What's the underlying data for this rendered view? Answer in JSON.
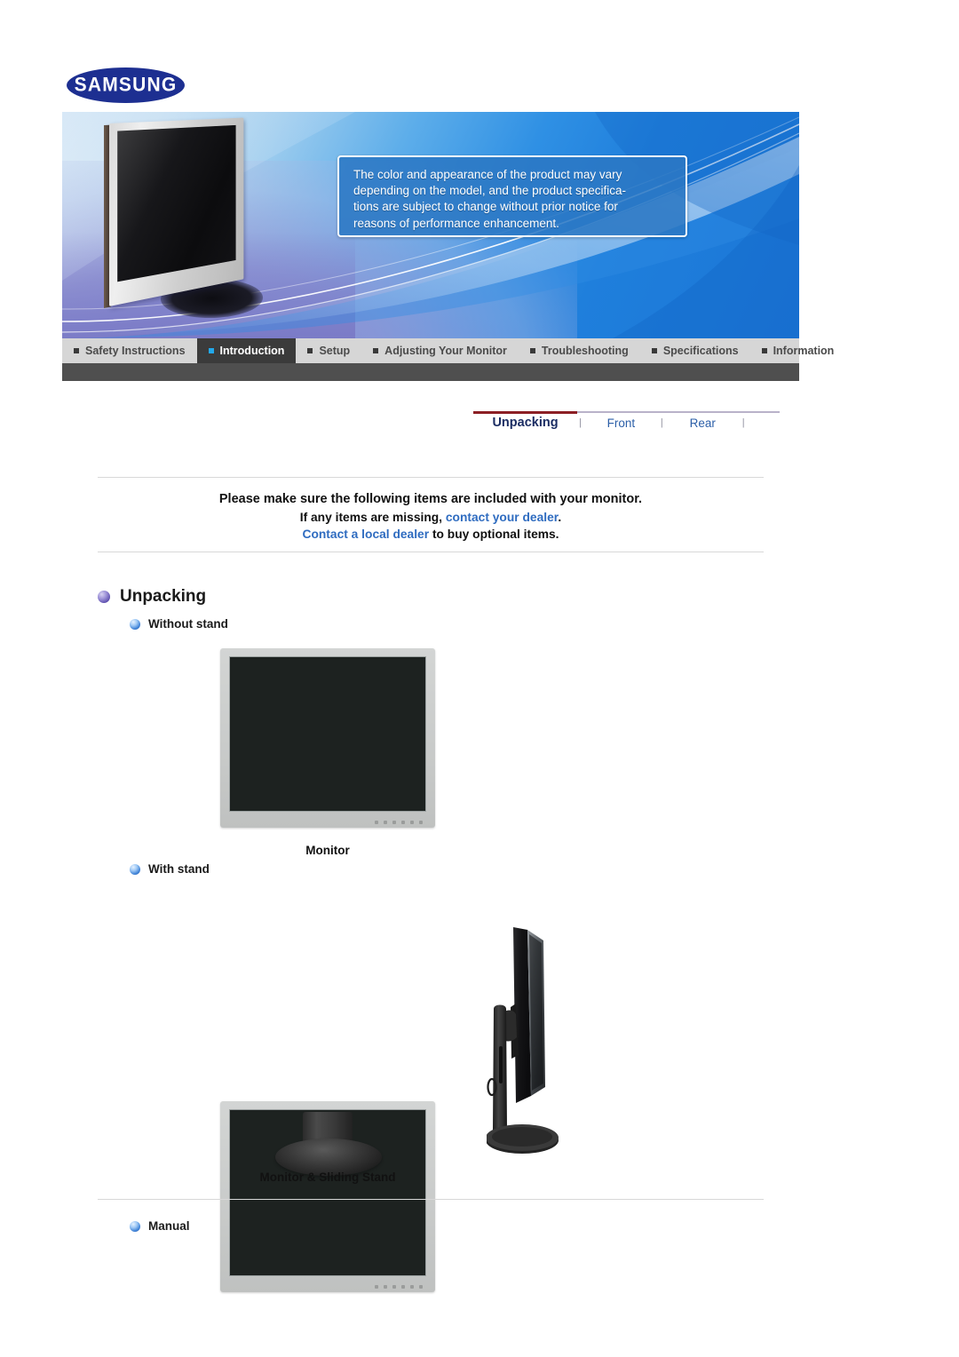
{
  "brand": {
    "name": "SAMSUNG"
  },
  "banner": {
    "notice_lines": [
      "The color and appearance of the product may vary",
      "depending on the model, and the product specifica-",
      "tions are subject to change without prior notice for",
      "reasons of performance enhancement."
    ],
    "notice_full": "The color and appearance of the product may vary depending on the model, and the product specifications are subject to change without prior notice for reasons of performance enhancement."
  },
  "main_nav": {
    "items": [
      {
        "label": "Safety Instructions",
        "active": false
      },
      {
        "label": "Introduction",
        "active": true
      },
      {
        "label": "Setup",
        "active": false
      },
      {
        "label": "Adjusting Your Monitor",
        "active": false
      },
      {
        "label": "Troubleshooting",
        "active": false
      },
      {
        "label": "Specifications",
        "active": false
      },
      {
        "label": "Information",
        "active": false
      }
    ]
  },
  "sub_nav": {
    "items": [
      {
        "label": "Unpacking",
        "active": true
      },
      {
        "label": "Front",
        "active": false
      },
      {
        "label": "Rear",
        "active": false
      }
    ],
    "separator": "|",
    "active_underline_color": "#8c1f24",
    "rule_color": "#b9b2c9"
  },
  "notice": {
    "line1": "Please make sure the following items are included with your monitor.",
    "line2_pre": "If any items are missing, ",
    "line2_link": "contact your dealer",
    "line2_post": ".",
    "line3_link": "Contact a local dealer",
    "line3_post": " to buy optional items.",
    "link_color": "#2f6cc0"
  },
  "section": {
    "title": "Unpacking",
    "groups": [
      {
        "label": "Without stand",
        "caption": "Monitor"
      },
      {
        "label": "With stand",
        "caption": "Monitor & Sliding Stand"
      },
      {
        "label": "Manual",
        "caption": ""
      }
    ]
  },
  "colors": {
    "samsung_blue": "#1d2f91",
    "banner_blue": "#1b76d6",
    "nav_bg": "#d6d6d6",
    "nav_active_bg": "#3b3b3b",
    "nav_active_marker": "#22a8ea",
    "nav_strip": "#4f4f4f",
    "link": "#2f6cc0",
    "heading": "#1a1a1a"
  },
  "icons": {
    "nav_marker": "square-marker-icon",
    "section_bullet": "purple-sphere-bullet-icon",
    "subsection_bullet": "blue-sphere-bullet-icon"
  }
}
